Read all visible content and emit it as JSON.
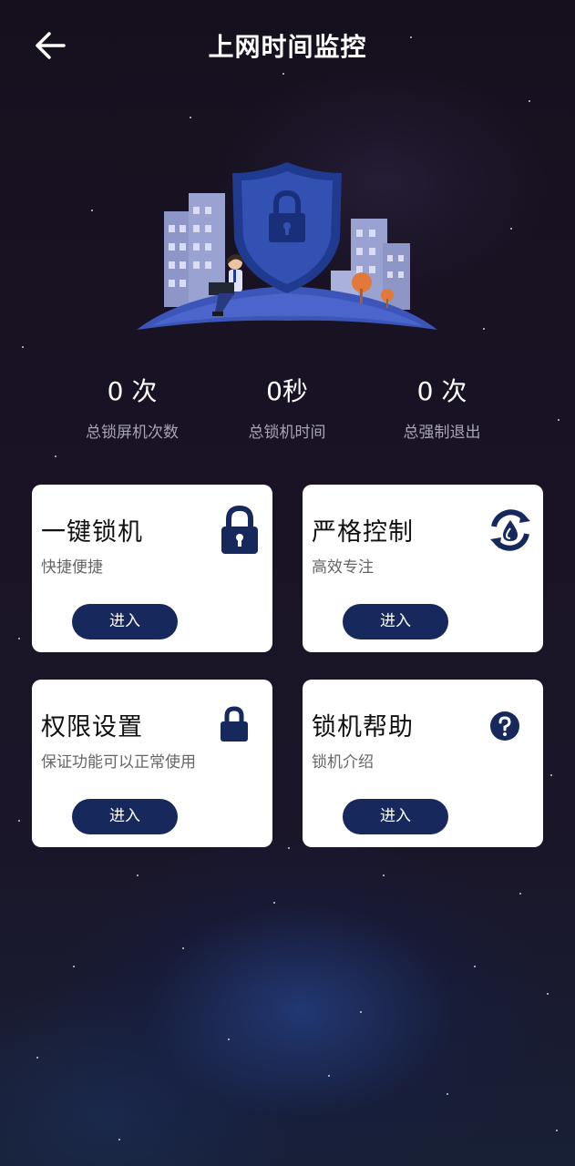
{
  "header": {
    "title": "上网时间监控"
  },
  "stats": [
    {
      "value": "0 次",
      "label": "总锁屏机次数"
    },
    {
      "value": "0秒",
      "label": "总锁机时间"
    },
    {
      "value": "0 次",
      "label": "总强制退出"
    }
  ],
  "cards": [
    {
      "title": "一键锁机",
      "subtitle": "快捷便捷",
      "button": "进入",
      "icon": "lock-icon"
    },
    {
      "title": "严格控制",
      "subtitle": "高效专注",
      "button": "进入",
      "icon": "refresh-drop-icon"
    },
    {
      "title": "权限设置",
      "subtitle": "保证功能可以正常使用",
      "button": "进入",
      "icon": "lock-small-icon"
    },
    {
      "title": "锁机帮助",
      "subtitle": "锁机介绍",
      "button": "进入",
      "icon": "help-icon"
    }
  ],
  "colors": {
    "accent": "#17285c",
    "background": "#1a1326",
    "card": "#ffffff"
  }
}
